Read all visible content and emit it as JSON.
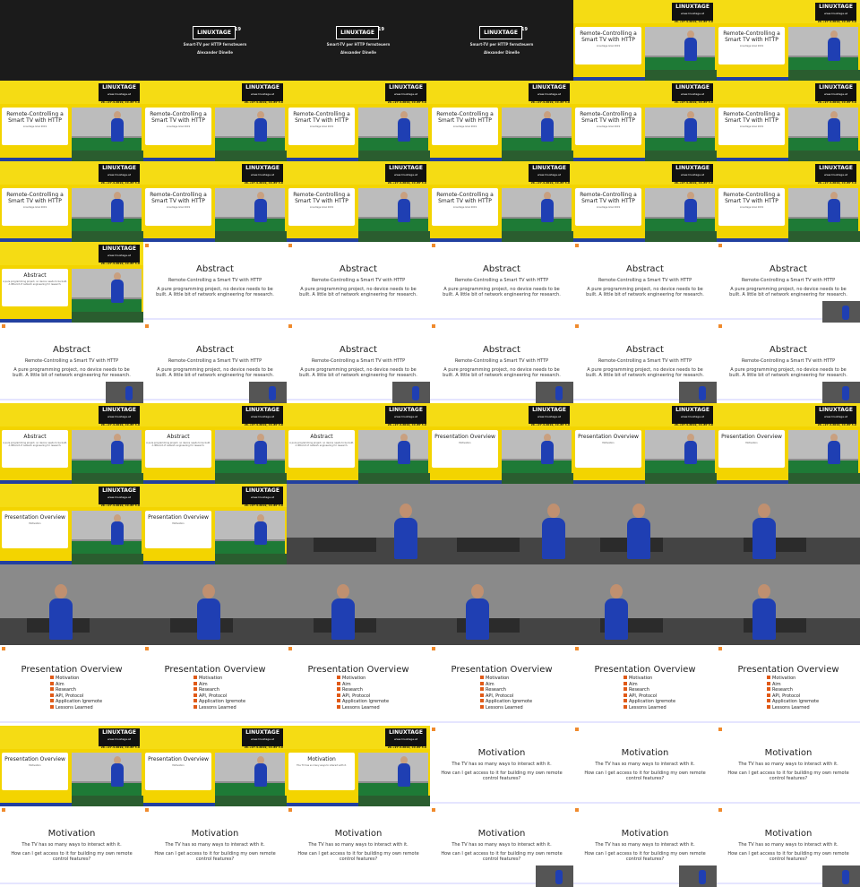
{
  "brand": {
    "logo": "LINUXTAGE",
    "year": "19",
    "url": "www.linuxtage.at",
    "dates": "26.+27.4.2019, CC-BY 3.0"
  },
  "intro": {
    "line1": "Smart-TV per HTTP fernsteuern",
    "line2": "Alexander Dinelle"
  },
  "title_card": {
    "title": "Remote-Controlling a Smart TV with HTTP",
    "sub1": "Alexander Dinelle, Alexander Dinelle",
    "sub2": "Linuxtage Graz 2019"
  },
  "abstract": {
    "heading": "Abstract",
    "line1": "Remote-Controlling a Smart TV with HTTP",
    "line2": "A pure programming project, no device needs to be built. A little bit of network engineering for research."
  },
  "overview": {
    "heading": "Presentation Overview",
    "items": [
      "Motivation",
      "Aim",
      "Research",
      "API, Protocol",
      "Application lgremote",
      "Lessons Learned"
    ]
  },
  "motivation": {
    "heading": "Motivation",
    "line1": "The TV has so many ways to interact with it.",
    "line2": "How can I get access to it for building my own remote control features?"
  },
  "colors": {
    "yellow": "#f3d400",
    "black": "#1b1b1b",
    "shirt": "#1f3fb3",
    "accent": "#e05a17"
  }
}
